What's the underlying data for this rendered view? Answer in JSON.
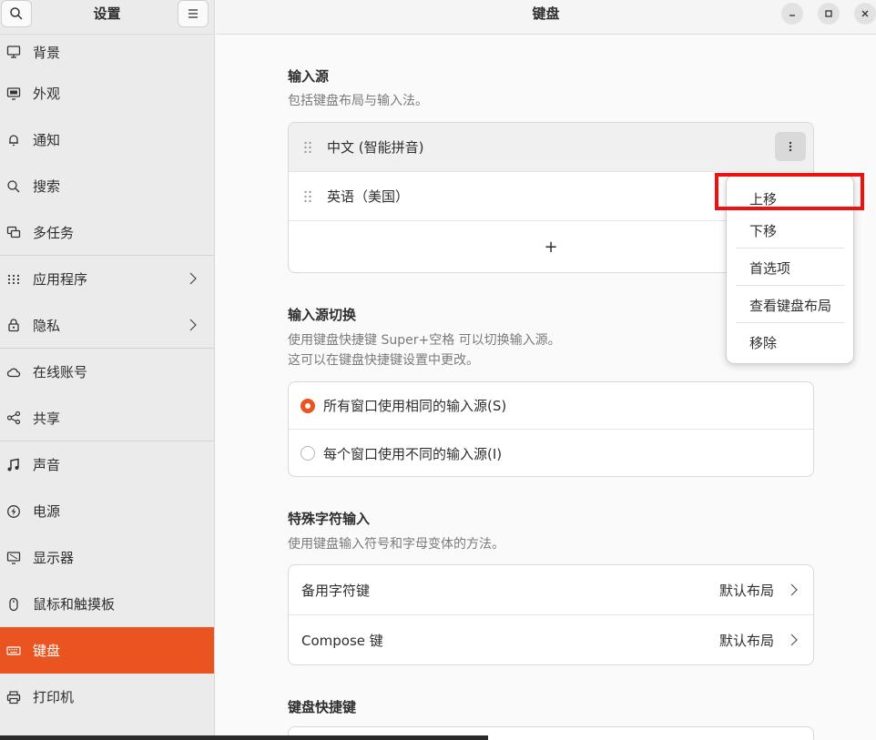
{
  "sidebar": {
    "title": "设置",
    "search_icon": "search-icon",
    "menu_icon": "hamburger-menu-icon",
    "items": [
      {
        "label": "背景",
        "icon": "display-icon"
      },
      {
        "label": "外观",
        "icon": "appearance-icon"
      },
      {
        "label": "通知",
        "icon": "bell-icon"
      },
      {
        "label": "搜索",
        "icon": "search-icon"
      },
      {
        "label": "多任务",
        "icon": "multitasking-icon"
      },
      {
        "label": "应用程序",
        "icon": "apps-grid-icon"
      },
      {
        "label": "隐私",
        "icon": "lock-icon"
      },
      {
        "label": "在线账号",
        "icon": "cloud-icon"
      },
      {
        "label": "共享",
        "icon": "share-icon"
      },
      {
        "label": "声音",
        "icon": "music-note-icon"
      },
      {
        "label": "电源",
        "icon": "power-icon"
      },
      {
        "label": "显示器",
        "icon": "monitor-icon"
      },
      {
        "label": "鼠标和触摸板",
        "icon": "mouse-icon"
      },
      {
        "label": "键盘",
        "icon": "keyboard-icon"
      },
      {
        "label": "打印机",
        "icon": "printer-icon"
      }
    ]
  },
  "main": {
    "title": "键盘",
    "input_sources": {
      "title": "输入源",
      "description": "包括键盘布局与输入法。",
      "items": [
        "中文 (智能拼音)",
        "英语（美国）"
      ],
      "add_label": "+"
    },
    "switching": {
      "title": "输入源切换",
      "description_line1": "使用键盘快捷键 Super+空格 可以切换输入源。",
      "description_line2": "这可以在键盘快捷键设置中更改。",
      "options": [
        "所有窗口使用相同的输入源(S)",
        "每个窗口使用不同的输入源(I)"
      ],
      "selected_index": 0
    },
    "special_chars": {
      "title": "特殊字符输入",
      "description": "使用键盘输入符号和字母变体的方法。",
      "rows": [
        {
          "label": "备用字符键",
          "value": "默认布局"
        },
        {
          "label": "Compose 键",
          "value": "默认布局"
        }
      ]
    },
    "shortcuts": {
      "title": "键盘快捷键"
    }
  },
  "popover_menu": {
    "items": [
      "上移",
      "下移",
      "首选项",
      "查看键盘布局",
      "移除"
    ]
  },
  "colors": {
    "accent": "#e95420",
    "annotation": "#ee1111"
  }
}
